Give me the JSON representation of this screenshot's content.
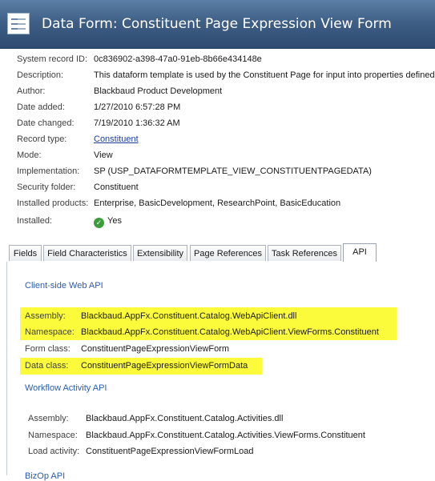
{
  "header": {
    "title": "Data Form:  Constituent Page Expression View Form"
  },
  "properties": [
    {
      "label": "System record ID:",
      "value": "0c836902-a398-47a0-91eb-8b66e434148e"
    },
    {
      "label": "Description:",
      "value": "This dataform template is used by the Constituent Page for input into properties defined"
    },
    {
      "label": "Author:",
      "value": "Blackbaud Product Development"
    },
    {
      "label": "Date added:",
      "value": "1/27/2010 6:57:28 PM"
    },
    {
      "label": "Date changed:",
      "value": "7/19/2010 1:36:32 AM"
    },
    {
      "label": "Record type:",
      "value": "Constituent"
    },
    {
      "label": "Mode:",
      "value": "View"
    },
    {
      "label": "Implementation:",
      "value": "SP (USP_DATAFORMTEMPLATE_VIEW_CONSTITUENTPAGEDATA)"
    },
    {
      "label": "Security folder:",
      "value": "Constituent"
    },
    {
      "label": "Installed products:",
      "value": "Enterprise, BasicDevelopment, ResearchPoint, BasicEducation"
    },
    {
      "label": "Installed:",
      "value": "Yes"
    }
  ],
  "tabs": [
    "Fields",
    "Field Characteristics",
    "Extensibility",
    "Page References",
    "Task References",
    "API"
  ],
  "active_tab": "API",
  "api": {
    "client": {
      "heading": "Client-side Web API",
      "assembly_label": "Assembly:",
      "assembly": "Blackbaud.AppFx.Constituent.Catalog.WebApiClient.dll",
      "namespace_label": "Namespace:",
      "namespace": "Blackbaud.AppFx.Constituent.Catalog.WebApiClient.ViewForms.Constituent",
      "form_class_label": "Form class:",
      "form_class": "ConstituentPageExpressionViewForm",
      "data_class_label": "Data class:",
      "data_class": "ConstituentPageExpressionViewFormData"
    },
    "workflow": {
      "heading": "Workflow Activity API",
      "assembly_label": "Assembly:",
      "assembly": "Blackbaud.AppFx.Constituent.Catalog.Activities.dll",
      "namespace_label": "Namespace:",
      "namespace": "Blackbaud.AppFx.Constituent.Catalog.Activities.ViewForms.Constituent",
      "load_activity_label": "Load activity:",
      "load_activity": "ConstituentPageExpressionViewFormLoad"
    },
    "bizop_heading": "BizOp API"
  },
  "colors": {
    "header_bg": "#3f5f86",
    "link": "#1f3f9f",
    "section": "#2a5db0",
    "highlight": "#fbfb3c",
    "success": "#3a9c3a"
  }
}
